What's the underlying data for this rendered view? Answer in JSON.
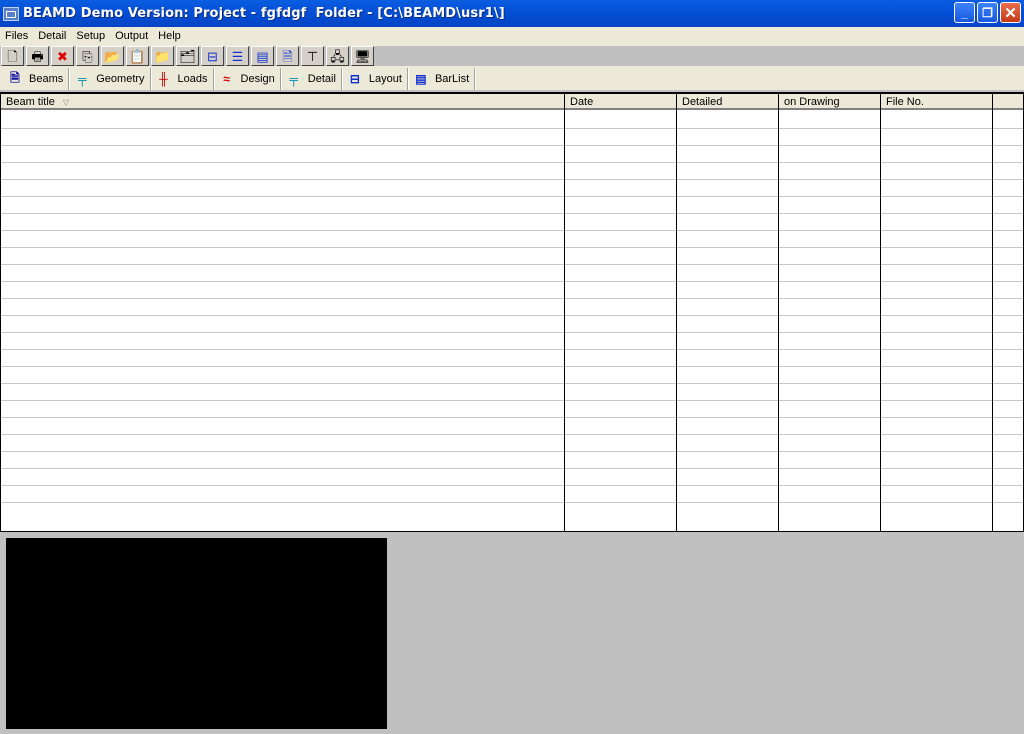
{
  "window": {
    "title": "BEAMD Demo Version: Project - fgfdgf  Folder - [C:\\BEAMD\\usr1\\]",
    "controls": {
      "minimize": "_",
      "restore": "❐",
      "close": "✕"
    }
  },
  "menu": [
    "Files",
    "Detail",
    "Setup",
    "Output",
    "Help"
  ],
  "toolbar": [
    {
      "name": "new-icon",
      "glyph": "🗋"
    },
    {
      "name": "print-icon",
      "glyph": "🖶"
    },
    {
      "name": "delete-icon",
      "glyph": "✖"
    },
    {
      "name": "copy-icon",
      "glyph": "⎘"
    },
    {
      "name": "folder-export-icon",
      "glyph": "📂"
    },
    {
      "name": "paste-icon",
      "glyph": "📋"
    },
    {
      "name": "folder-icon",
      "glyph": "📁"
    },
    {
      "name": "folder-open-icon",
      "glyph": "🗂"
    },
    {
      "name": "layout-icon",
      "glyph": "⊟"
    },
    {
      "name": "geometry-icon",
      "glyph": "☰"
    },
    {
      "name": "barlist-icon",
      "glyph": "▤"
    },
    {
      "name": "document-icon",
      "glyph": "🗎"
    },
    {
      "name": "section-icon",
      "glyph": "⊤"
    },
    {
      "name": "network-icon",
      "glyph": "🖧"
    },
    {
      "name": "monitor-icon",
      "glyph": "🖥"
    }
  ],
  "tabs": [
    {
      "label": "Beams",
      "icon": "beams-icon",
      "glyph": "🗎",
      "color": "#1010a0"
    },
    {
      "label": "Geometry",
      "icon": "geometry-icon",
      "glyph": "╤",
      "color": "#0090b0"
    },
    {
      "label": "Loads",
      "icon": "loads-icon",
      "glyph": "╫",
      "color": "#d00000"
    },
    {
      "label": "Design",
      "icon": "design-icon",
      "glyph": "≈",
      "color": "#d00000"
    },
    {
      "label": "Detail",
      "icon": "detail-icon",
      "glyph": "╤",
      "color": "#0090b0"
    },
    {
      "label": "Layout",
      "icon": "layout-icon",
      "glyph": "⊟",
      "color": "#1030d0"
    },
    {
      "label": "BarList",
      "icon": "barlist-icon",
      "glyph": "▤",
      "color": "#1030d0"
    }
  ],
  "table": {
    "columns": [
      "Beam title",
      "Date",
      "Detailed",
      "on Drawing",
      "File No.",
      ""
    ],
    "sort_indicator": "▽",
    "row_count": 23
  }
}
